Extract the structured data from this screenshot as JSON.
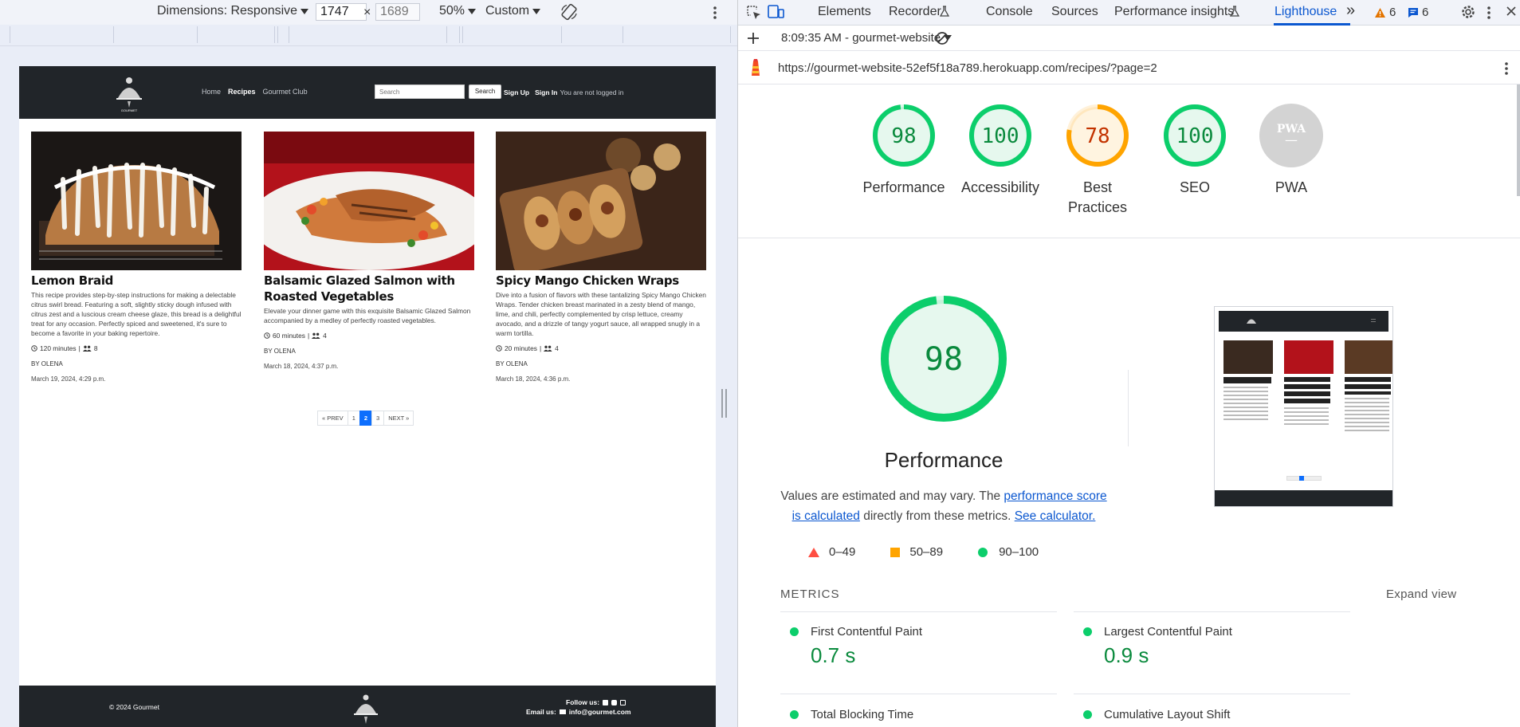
{
  "device_toolbar": {
    "dimensions_label": "Dimensions: Responsive",
    "width_value": "1747",
    "times": "×",
    "height_placeholder": "1689",
    "zoom": "50%",
    "throttle": "Custom"
  },
  "site": {
    "brand": "GOURMET",
    "nav": [
      "Home",
      "Recipes",
      "Gourmet Club"
    ],
    "search_placeholder": "Search",
    "search_button": "Search",
    "sign_up": "Sign Up",
    "sign_in": "Sign In",
    "login_status": "You are not logged in",
    "recipes": [
      {
        "title": "Lemon Braid",
        "description": "This recipe provides step-by-step instructions for making a delectable citrus swirl bread. Featuring a soft, slightly sticky dough infused with citrus zest and a luscious cream cheese glaze, this bread is a delightful treat for any occasion. Perfectly spiced and sweetened, it's sure to become a favorite in your baking repertoire.",
        "time": "120 minutes",
        "sep": "|",
        "servings": "8",
        "author": "BY OLENA",
        "date": "March 19, 2024, 4:29 p.m."
      },
      {
        "title": "Balsamic Glazed Salmon with Roasted Vegetables",
        "description": "Elevate your dinner game with this exquisite Balsamic Glazed Salmon accompanied by a medley of perfectly roasted vegetables.",
        "time": "60 minutes",
        "sep": "|",
        "servings": "4",
        "author": "BY OLENA",
        "date": "March 18, 2024, 4:37 p.m."
      },
      {
        "title": "Spicy Mango Chicken Wraps",
        "description": "Dive into a fusion of flavors with these tantalizing Spicy Mango Chicken Wraps. Tender chicken breast marinated in a zesty blend of mango, lime, and chili, perfectly complemented by crisp lettuce, creamy avocado, and a drizzle of tangy yogurt sauce, all wrapped snugly in a warm tortilla.",
        "time": "20 minutes",
        "sep": "|",
        "servings": "4",
        "author": "BY OLENA",
        "date": "March 18, 2024, 4:36 p.m."
      }
    ],
    "pagination": {
      "prev": "« PREV",
      "pages": [
        "1",
        "2",
        "3"
      ],
      "current": "2",
      "next": "NEXT »"
    },
    "footer": {
      "copyright": "© 2024 Gourmet",
      "follow_label": "Follow us:",
      "email_label": "Email us:",
      "email": "info@gourmet.com"
    }
  },
  "devtools": {
    "tabs": [
      "Elements",
      "Recorder",
      "Console",
      "Sources",
      "Performance insights",
      "Lighthouse"
    ],
    "active_tab": "Lighthouse",
    "more": "»",
    "warnings_count": "6",
    "messages_count": "6",
    "report_selector": "8:09:35 AM - gourmet-website",
    "url": "https://gourmet-website-52ef5f18a789.herokuapp.com/recipes/?page=2",
    "scores": [
      {
        "label": "Performance",
        "score": 98,
        "status": "pass",
        "color": "#0cce6b"
      },
      {
        "label": "Accessibility",
        "score": 100,
        "status": "pass",
        "color": "#0cce6b"
      },
      {
        "label": "Best Practices",
        "score": 78,
        "status": "average",
        "color": "#ffa400"
      },
      {
        "label": "SEO",
        "score": 100,
        "status": "pass",
        "color": "#0cce6b"
      },
      {
        "label": "PWA",
        "score": null,
        "status": "na",
        "color": "#d3d3d3"
      }
    ],
    "pwa_badge": "PWA",
    "pwa_dash": "—",
    "main_score": {
      "label": "Performance",
      "score": 98
    },
    "note_text_1": "Values are estimated and may vary. The",
    "note_link_1": "performance score is calculated",
    "note_text_2": "directly from these metrics.",
    "note_link_2": "See calculator.",
    "legend": [
      {
        "range": "0–49",
        "shape": "triangle",
        "color": "#ff4e42"
      },
      {
        "range": "50–89",
        "shape": "square",
        "color": "#ffa400"
      },
      {
        "range": "90–100",
        "shape": "circle",
        "color": "#0cce6b"
      }
    ],
    "metrics_header": "METRICS",
    "expand_view": "Expand view",
    "metrics": [
      {
        "name": "First Contentful Paint",
        "value": "0.7 s"
      },
      {
        "name": "Largest Contentful Paint",
        "value": "0.9 s"
      },
      {
        "name": "Total Blocking Time",
        "value": ""
      },
      {
        "name": "Cumulative Layout Shift",
        "value": ""
      }
    ],
    "colors": {
      "pass": "#0cce6b",
      "average": "#ffa400",
      "fail": "#ff4e42",
      "accent": "#0b57d0"
    }
  }
}
